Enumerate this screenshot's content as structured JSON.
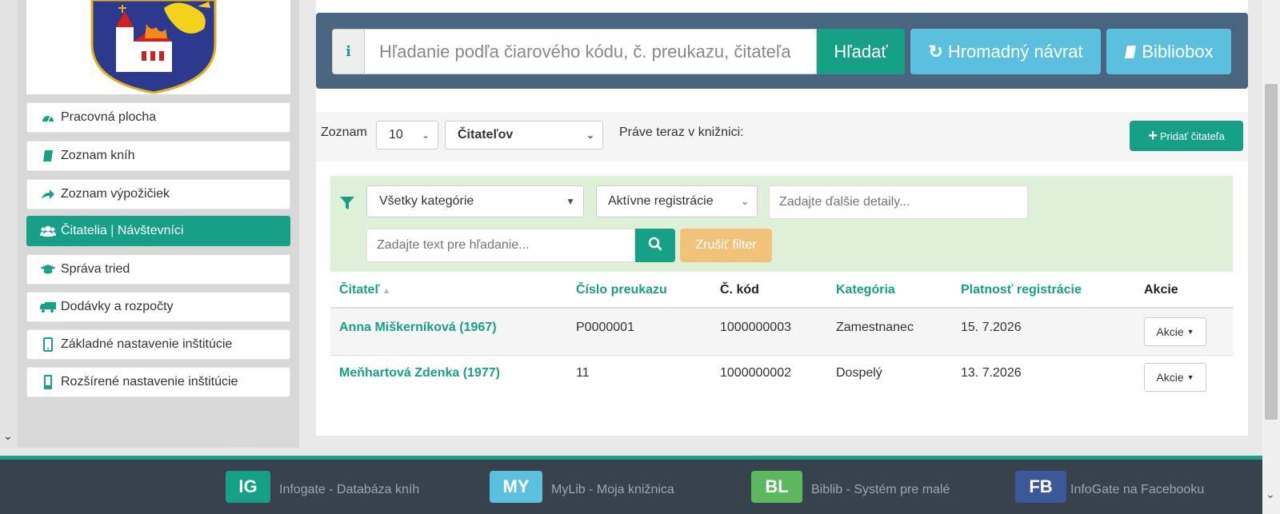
{
  "sidebar": {
    "items": [
      {
        "label": "Pracovná plocha",
        "icon": "dashboard-icon"
      },
      {
        "label": "Zoznam kníh",
        "icon": "book-icon"
      },
      {
        "label": "Zoznam výpožičiek",
        "icon": "share-icon"
      },
      {
        "label": "Čitatelia | Návštevníci",
        "icon": "users-icon",
        "active": true
      },
      {
        "label": "Správa tried",
        "icon": "graduation-cap-icon"
      },
      {
        "label": "Dodávky a rozpočty",
        "icon": "truck-icon"
      },
      {
        "label": "Základné nastavenie inštitúcie",
        "icon": "tablet-icon"
      },
      {
        "label": "Rozšírené nastavenie inštitúcie",
        "icon": "mobile-icon"
      }
    ]
  },
  "search": {
    "info_glyph": "i",
    "placeholder": "Hľadanie podľa čiarového kódu, č. preukazu, čitateľa",
    "search_label": "Hľadať",
    "bulk_return_label": "Hromadný návrat",
    "bibliobox_label": "Bibliobox"
  },
  "toolbar": {
    "list_label": "Zoznam",
    "page_size": "10",
    "type_select": "Čitateľov",
    "now_in_library_label": "Práve teraz v knižnici:",
    "add_reader_label": "Pridať čitateľa"
  },
  "filter": {
    "category_select": "Všetky kategórie",
    "registration_select": "Aktívne registrácie",
    "details_placeholder": "Zadajte ďalšie detaily...",
    "text_placeholder": "Zadajte text pre hľadanie...",
    "clear_label": "Zrušiť filter"
  },
  "table": {
    "headers": {
      "reader": "Čitateľ",
      "card_number": "Číslo preukazu",
      "barcode": "Č. kód",
      "category": "Kategória",
      "validity": "Platnosť registrácie",
      "actions": "Akcie"
    },
    "rows": [
      {
        "reader": "Anna Miškerníková (1967)",
        "card_number": "P0000001",
        "barcode": "1000000003",
        "category": "Zamestnanec",
        "validity": "15. 7.2026",
        "action": "Akcie"
      },
      {
        "reader": "Meňhartová Zdenka (1977)",
        "card_number": "11",
        "barcode": "1000000002",
        "category": "Dospelý",
        "validity": "13. 7.2026",
        "action": "Akcie"
      }
    ]
  },
  "footer": {
    "links": [
      {
        "badge": "IG",
        "text": "Infogate - Databáza kníh",
        "color": "#16a085"
      },
      {
        "badge": "MY",
        "text": "MyLib - Moja knižnica",
        "color": "#5bc0de"
      },
      {
        "badge": "BL",
        "text": "Biblib - Systém pre malé",
        "color": "#5cb85c"
      },
      {
        "badge": "FB",
        "text": "InfoGate na Facebooku",
        "color": "#3b5998"
      }
    ]
  },
  "colors": {
    "accent": "#16a085",
    "info": "#5bc0de",
    "warning": "#f0c27a",
    "search_bar": "#4a6580",
    "footer": "#37424d"
  }
}
